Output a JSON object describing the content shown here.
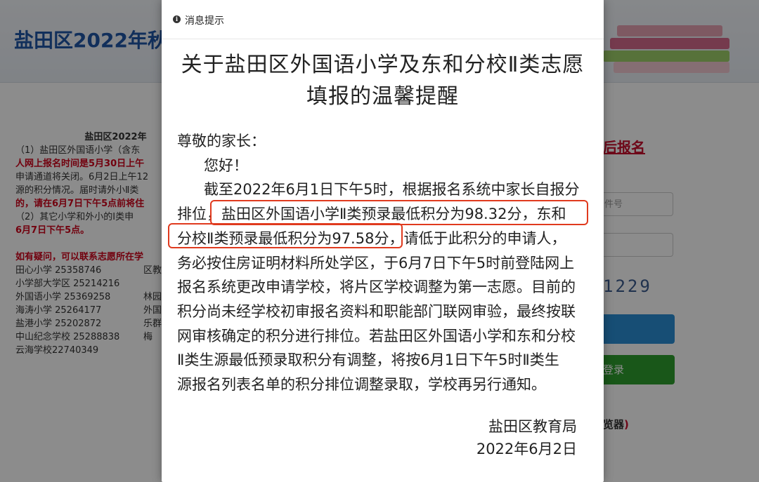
{
  "background_page": {
    "site_title": "盐田区2022年秋",
    "notice_title": "盐田区2022年",
    "notice_lines": [
      {
        "text": "（1）盐田区外国语小学（含东",
        "red": false
      },
      {
        "text": "人网上报名时间是5月30日上午",
        "red": true
      },
      {
        "text": "申请通道将关闭。6月2日上午12",
        "red": false
      },
      {
        "text": "源的积分情况。届时请外小Ⅱ类",
        "red": false
      },
      {
        "text": "的，请在6月7日下午5点前将住",
        "red": true
      },
      {
        "text": "（2）其它小学和外小的Ⅰ类申",
        "red": false
      },
      {
        "text": "6月7日下午5点。",
        "red": true
      },
      {
        "text": "",
        "red": false
      },
      {
        "text": "如有疑问，可以联系志愿所在学",
        "red": true
      }
    ],
    "contacts": [
      {
        "left": "田心小学 25358746",
        "right": "区教"
      },
      {
        "left": "小学部大学区 25214216",
        "right": ""
      },
      {
        "left": "外国语小学 25369258",
        "right": "林园"
      },
      {
        "left": "海涛小学 25264177",
        "right": "外国"
      },
      {
        "left": "盐港小学 25202872",
        "right": "乐群"
      },
      {
        "left": "中山纪念学校 25288838",
        "right": "梅"
      },
      {
        "left": "云海学校22740349",
        "right": ""
      }
    ],
    "register_title": "后报名",
    "id_placeholder": "件号",
    "captcha": "1229",
    "login_button": "登录",
    "browser_note": "览器",
    "browser_note_paren": ")"
  },
  "modal": {
    "header_title": "消息提示",
    "heading_line1": "关于盐田区外国语小学及东和分校Ⅱ类志愿",
    "heading_line2": "填报的温馨提醒",
    "greeting": "尊敬的家长：",
    "hello": "您好！",
    "body_lines": [
      "截至2022年6月1日下午5时，根据报名系统中家长自报分",
      "排位，",
      "盐田区外国语小学Ⅱ类预录最低积分为98.32分，东和",
      "分校Ⅱ类预录最低积分为97.58分",
      "，请低于此积分的申请人，",
      "务必按住房证明材料所处学区，于6月7日下午5时前登陆网上",
      "报名系统更改申请学校，将片区学校调整为第一志愿。目前的",
      "积分尚未经学校初审报名资料和职能部门联网审验，最终按联",
      "网审核确定的积分进行排位。若盐田区外国语小学和东和分校",
      "Ⅱ类生源最低预录取积分有调整，将按6月1日下午5时Ⅱ类生",
      "源报名列表名单的积分排位调整录取，学校再另行通知。"
    ],
    "signature": "盐田区教育局",
    "date": "2022年6月2日",
    "highlight_color": "#e03a1e"
  }
}
